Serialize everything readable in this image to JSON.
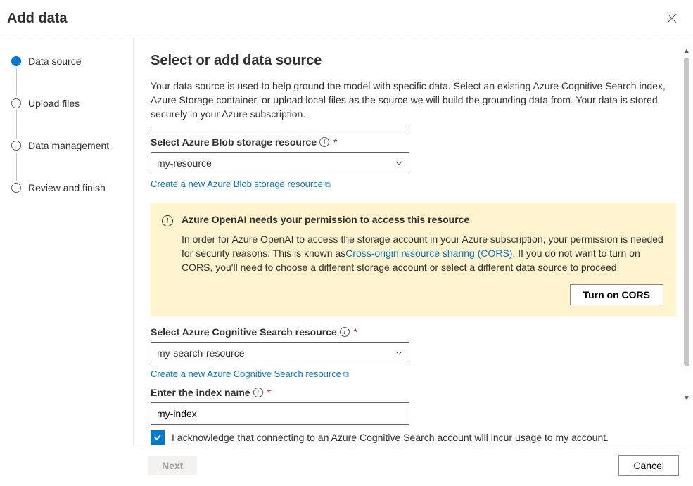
{
  "header": {
    "title": "Add data"
  },
  "stepper": {
    "steps": [
      {
        "label": "Data source",
        "active": true
      },
      {
        "label": "Upload files",
        "active": false
      },
      {
        "label": "Data management",
        "active": false
      },
      {
        "label": "Review and finish",
        "active": false
      }
    ]
  },
  "main": {
    "heading": "Select or add data source",
    "intro": "Your data source is used to help ground the model with specific data. Select an existing Azure Cognitive Search index, Azure Storage container, or upload local files as the source we will build the grounding data from. Your data is stored securely in your Azure subscription.",
    "blob_label": "Select Azure Blob storage resource",
    "blob_value": "my-resource",
    "blob_link": "Create a new Azure Blob storage resource",
    "banner": {
      "title": "Azure OpenAI needs your permission to access this resource",
      "text_before": "In order for Azure OpenAI to access the storage account in your Azure subscription, your permission is needed for security reasons. This is known as",
      "link_text": "Cross-origin resource sharing (CORS)",
      "text_after": ". If you do not want to turn on CORS, you'll need to choose a different storage account or select a different data source to proceed.",
      "button": "Turn on CORS"
    },
    "search_label": "Select Azure Cognitive Search resource",
    "search_value": "my-search-resource",
    "search_link": "Create a new Azure Cognitive Search resource",
    "index_label": "Enter the index name",
    "index_value": "my-index",
    "ack_label": "I acknowledge that connecting to an Azure Cognitive Search account will incur usage to my account.",
    "ack_checked": true
  },
  "footer": {
    "next": "Next",
    "cancel": "Cancel"
  }
}
